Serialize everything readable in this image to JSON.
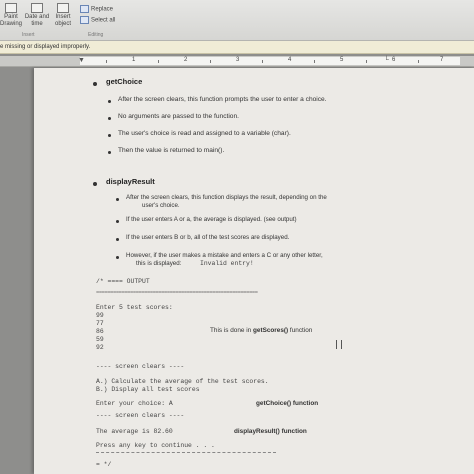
{
  "ribbon": {
    "items": [
      {
        "label": "Paint\nDrawing",
        "icon": "paint-icon"
      },
      {
        "label": "Date and\ntime",
        "icon": "calendar-icon"
      },
      {
        "label": "Insert\nobject",
        "icon": "object-icon"
      }
    ],
    "replace_label": "Replace",
    "select_all_label": "Select all",
    "group_insert": "Insert",
    "group_editing": "Editing"
  },
  "message_bar": {
    "text": "e missing or displayed improperly."
  },
  "ruler": {
    "numbers": [
      "1",
      "2",
      "3",
      "4",
      "5",
      "6",
      "7"
    ]
  },
  "doc": {
    "heading_getchoice": "getChoice",
    "getchoice_bullets": [
      "After the screen clears, this function prompts the user to enter a choice.",
      "No arguments are passed to the function.",
      "The user's choice is read and assigned to a variable (char).",
      "Then the value is returned to main()."
    ],
    "heading_display": "displayResult",
    "display_bullets": [
      {
        "line1": "After the screen clears, this function displays the result, depending on the",
        "line2": "user's choice."
      },
      {
        "line1": "If the user enters A or a, the average is displayed.  (see output)",
        "line2": ""
      },
      {
        "line1": "If the user enters B or b, all of the test scores are displayed.",
        "line2": ""
      },
      {
        "line1": "However, if the user makes a mistake and enters a C or any other letter,",
        "line2": "this is displayed:",
        "code": "Invalid entry!"
      }
    ],
    "output_heading": "/* ==== OUTPUT",
    "output_rule": "=========================================================",
    "enter_scores": "Enter 5 test scores:",
    "scores": [
      "99",
      "77",
      "86",
      "59",
      "92"
    ],
    "annot_getscores_prefix": "This is done in ",
    "annot_getscores_bold": "getScores()",
    "annot_getscores_suffix": " function",
    "screen_clears_1": "---- screen clears ----",
    "menu_a": "A.)  Calculate the average of the test scores.",
    "menu_b": "B.)  Display all test scores",
    "enter_choice": "Enter your choice:   A",
    "annot_getchoice": "getChoice() function",
    "screen_clears_2": "---- screen clears ----",
    "average_line": "The average is 82.60",
    "annot_display": "displayResult() function",
    "press_any_key": "Press any key to continue . . .",
    "comment_end": "= */"
  }
}
